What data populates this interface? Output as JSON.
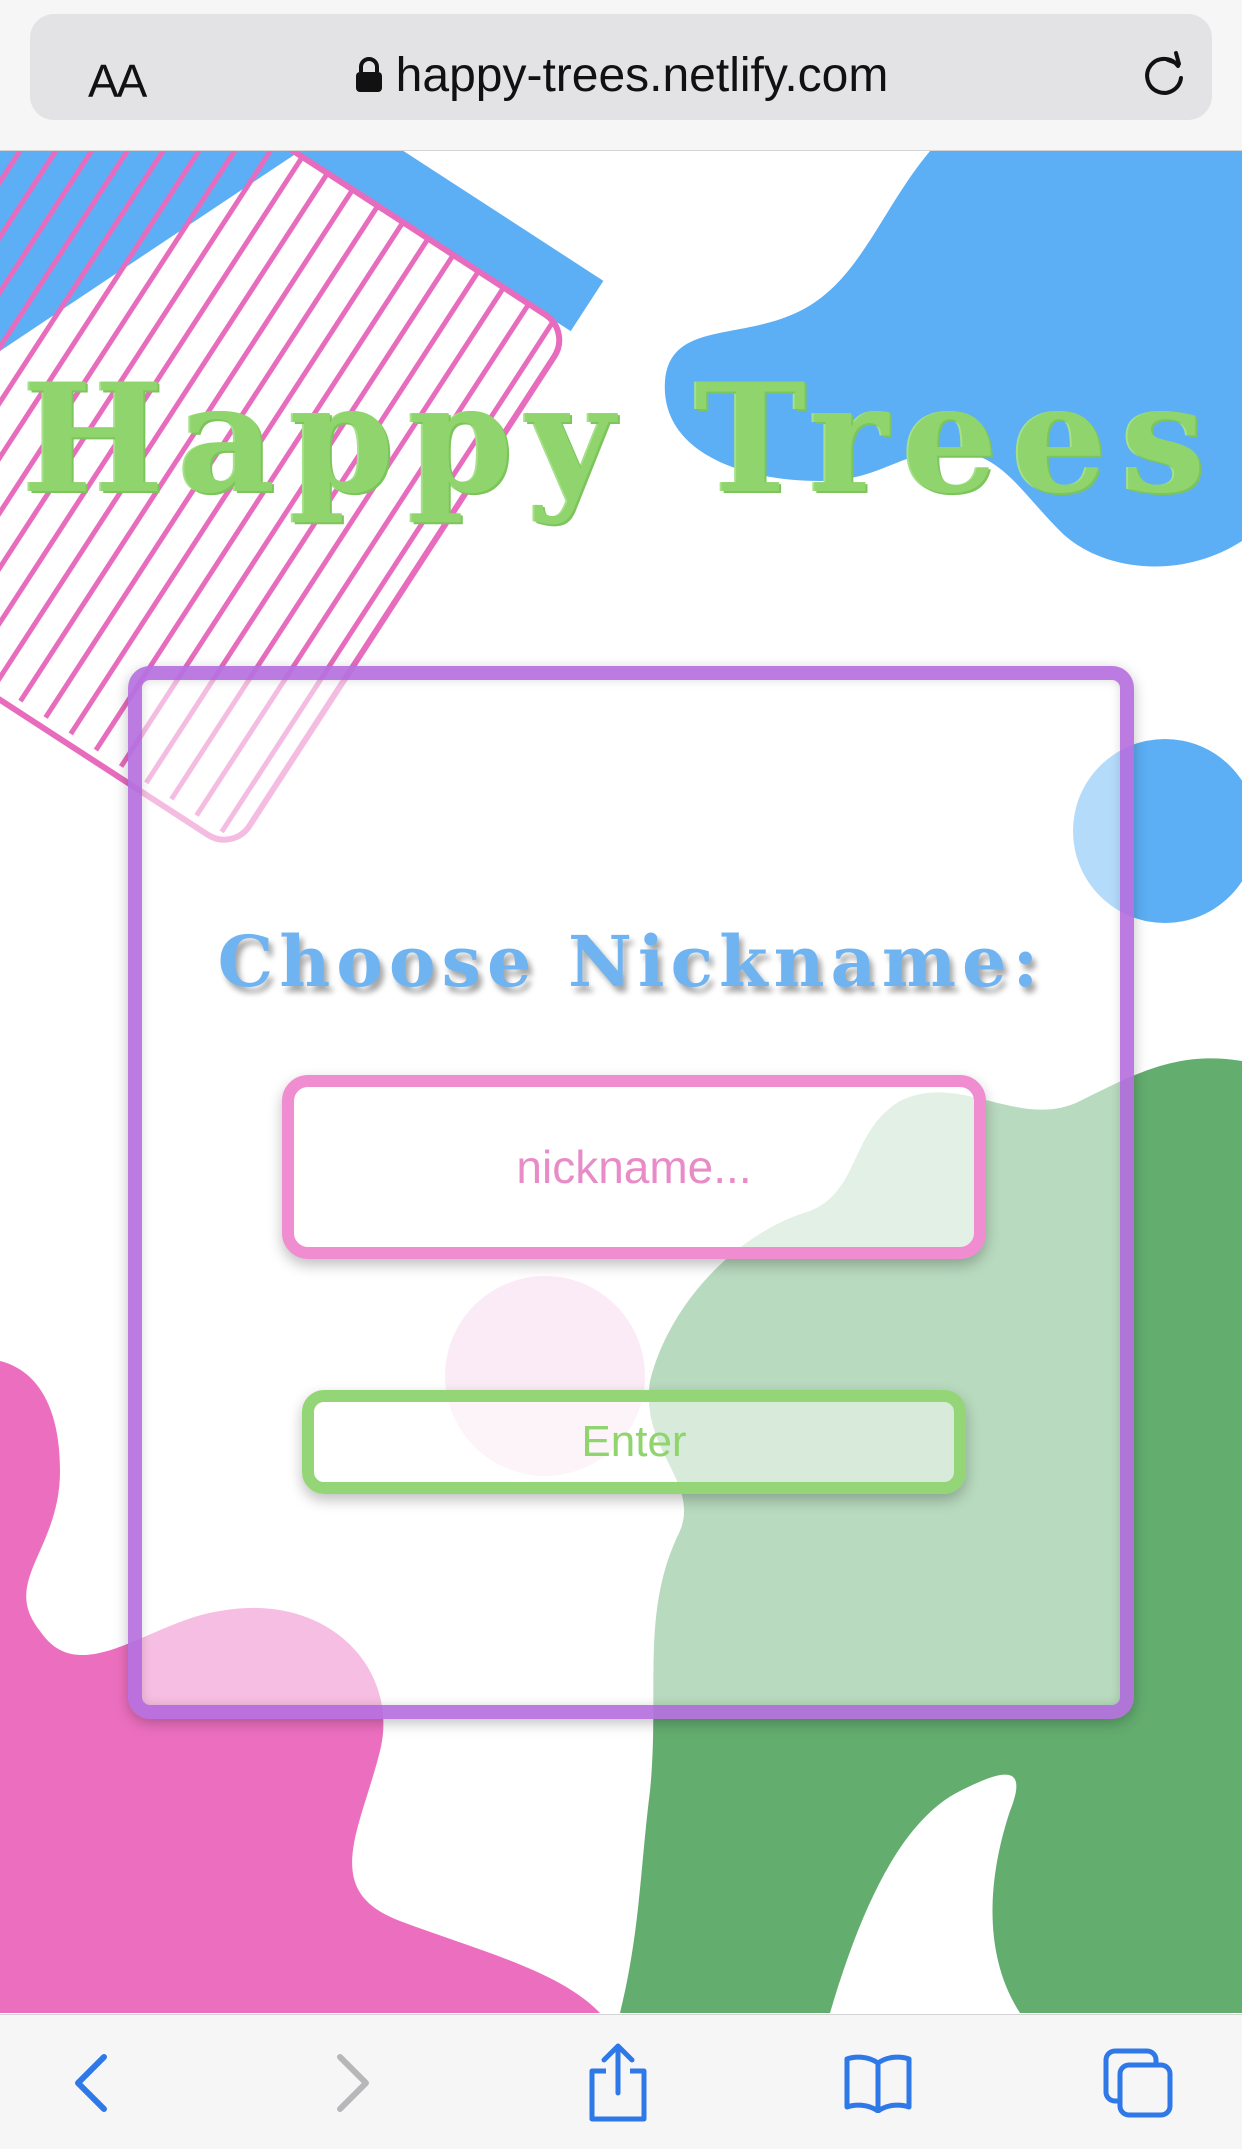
{
  "browser": {
    "text_size_label": "AA",
    "url": "happy-trees.netlify.com",
    "accent": "#2f78e8"
  },
  "page": {
    "title": "Happy Trees",
    "prompt": "Choose Nickname:",
    "nickname_placeholder": "nickname...",
    "enter_label": "Enter",
    "colors": {
      "title_green": "#8fd46c",
      "prompt_blue": "#6fb4f0",
      "input_pink": "#ef8dd0",
      "card_purple": "#af64dc",
      "button_green": "#94d677"
    }
  },
  "toolbar": {
    "icons": [
      "back-icon",
      "forward-icon",
      "share-icon",
      "bookmarks-icon",
      "tabs-icon"
    ]
  }
}
